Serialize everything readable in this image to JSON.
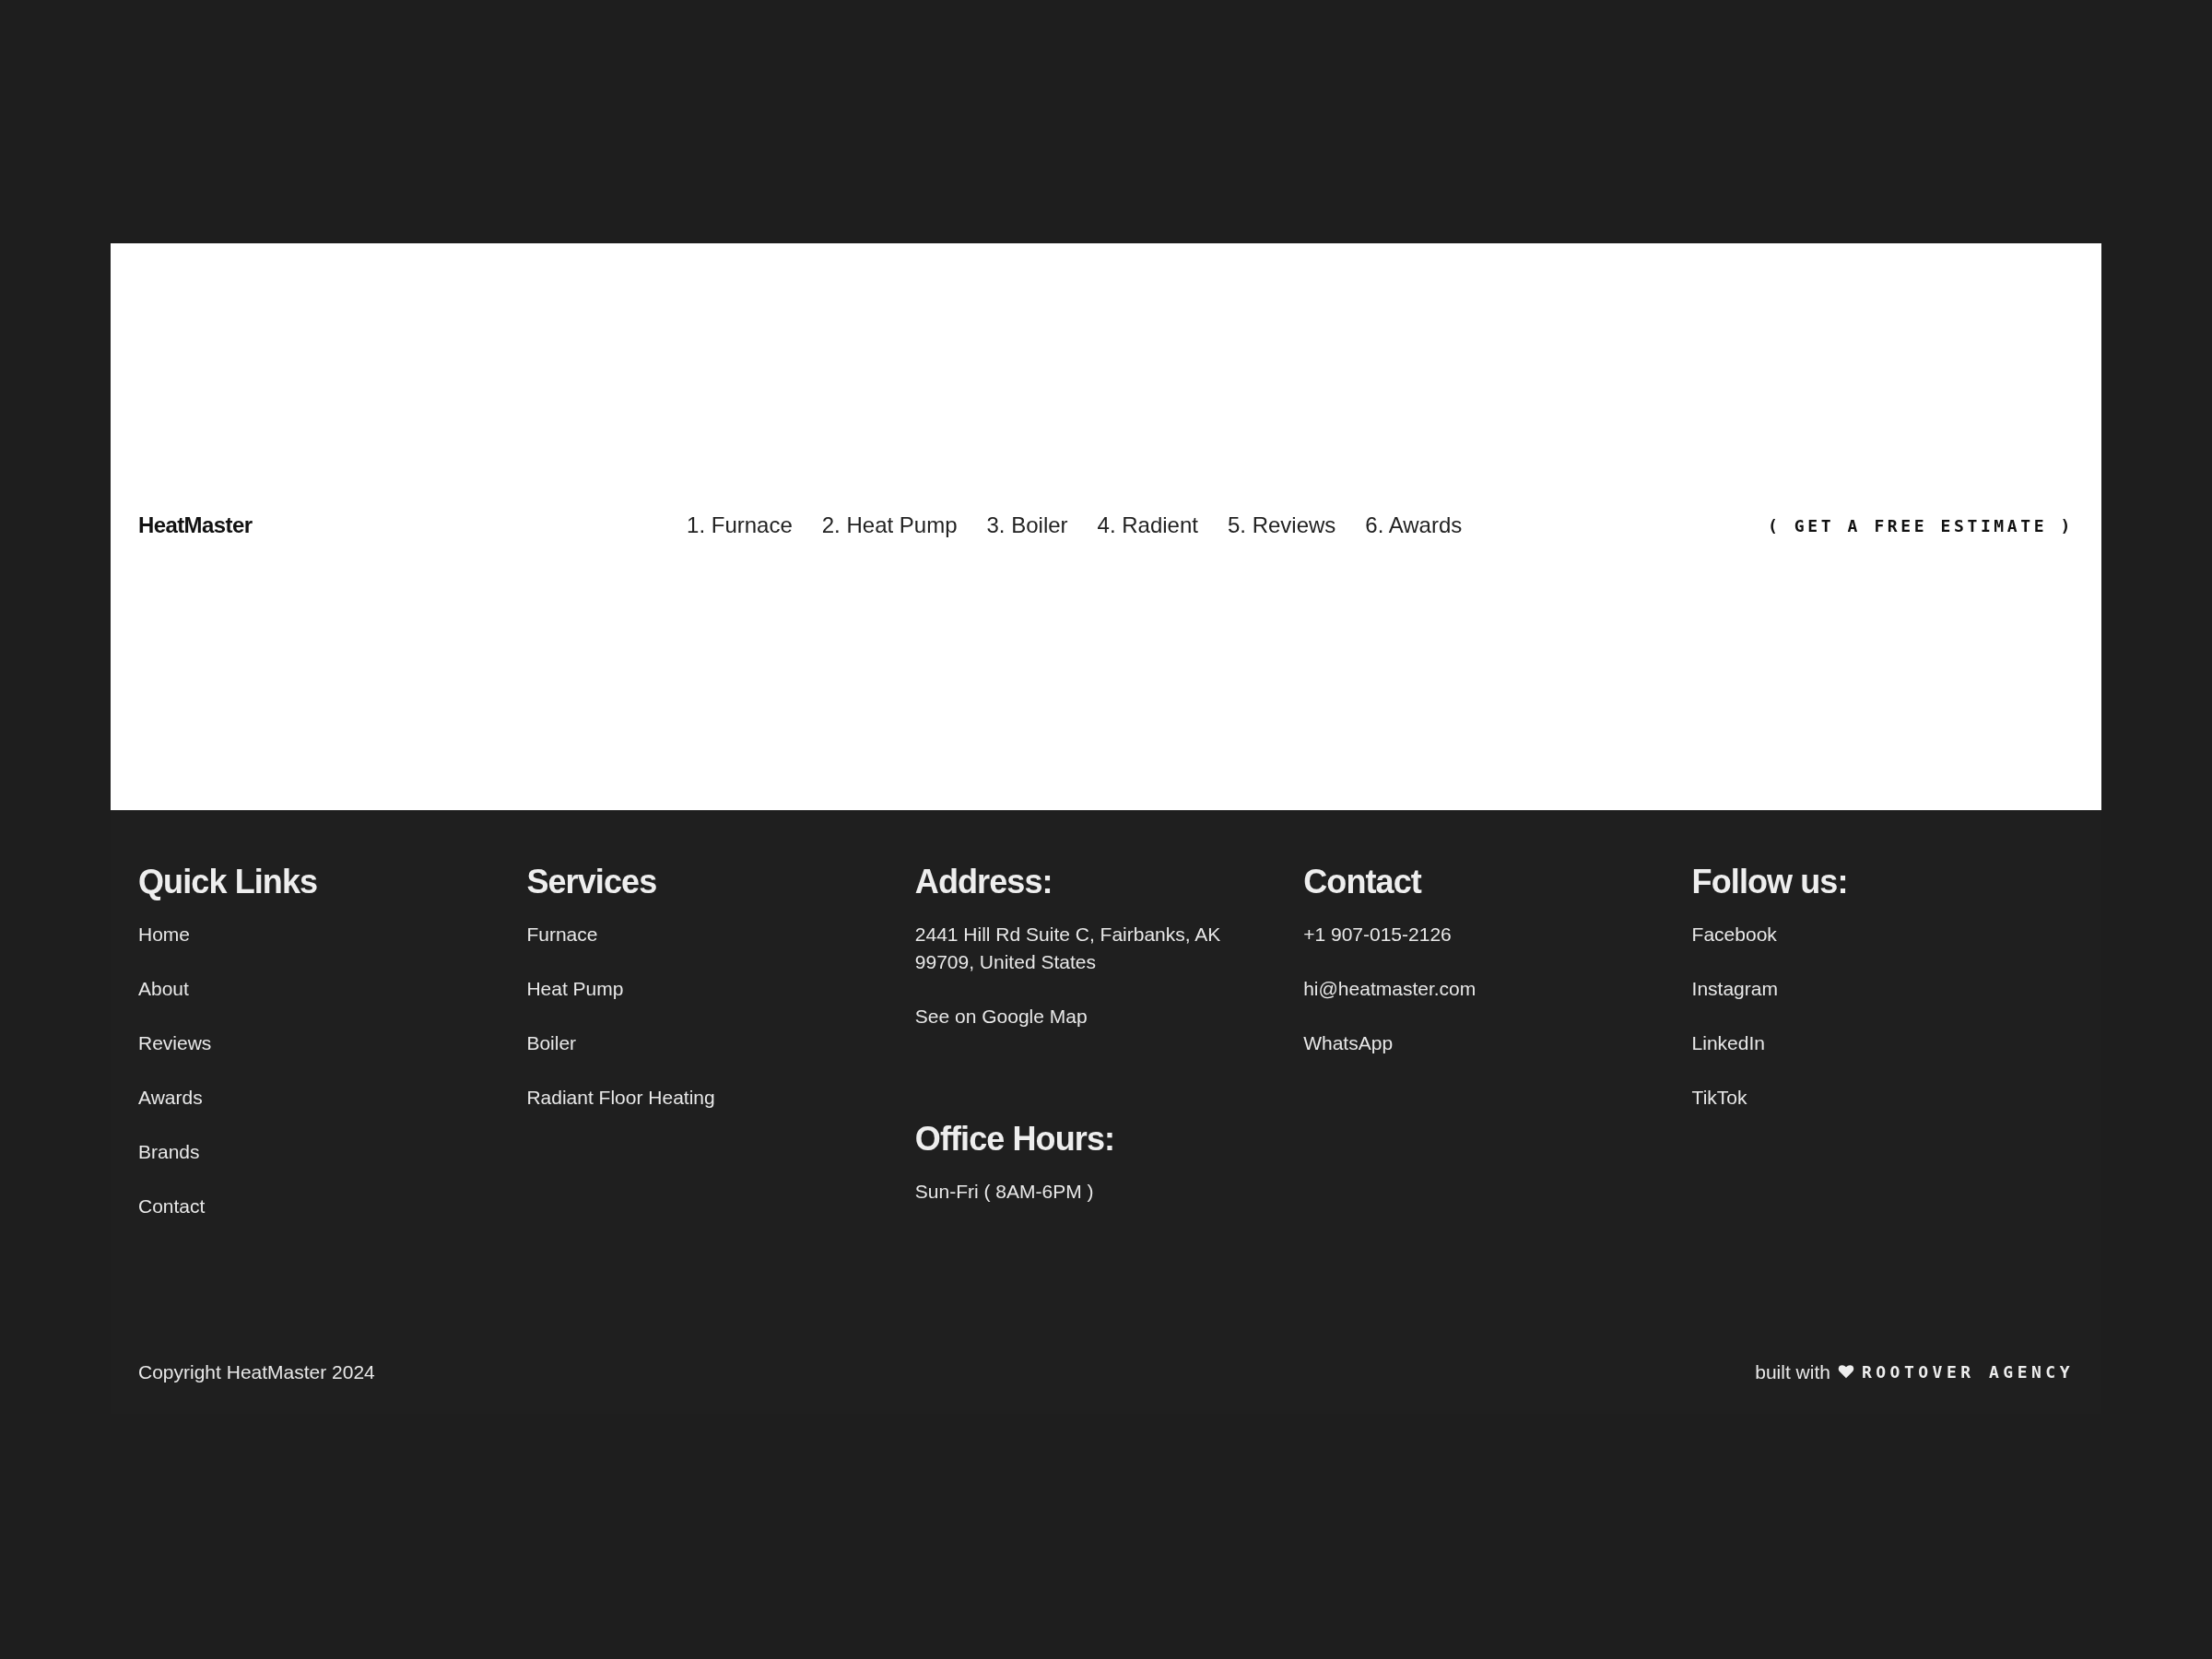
{
  "header": {
    "logo": "HeatMaster",
    "nav": [
      "1. Furnace",
      "2. Heat Pump",
      "3. Boiler",
      "4. Radient",
      "5. Reviews",
      "6. Awards"
    ],
    "cta": "( GET A FREE ESTIMATE )"
  },
  "footer": {
    "columns": [
      {
        "sections": [
          {
            "heading": "Quick Links",
            "links": [
              "Home",
              "About",
              "Reviews",
              "Awards",
              "Brands",
              "Contact"
            ]
          }
        ]
      },
      {
        "sections": [
          {
            "heading": "Services",
            "links": [
              "Furnace",
              "Heat Pump",
              "Boiler",
              "Radiant Floor Heating"
            ]
          }
        ]
      },
      {
        "sections": [
          {
            "heading": "Address:",
            "links": [
              "2441 Hill Rd Suite C, Fairbanks, AK 99709, United States",
              "See on Google Map"
            ]
          },
          {
            "heading": "Office Hours:",
            "links": [
              "Sun-Fri ( 8AM-6PM )"
            ]
          }
        ]
      },
      {
        "sections": [
          {
            "heading": "Contact",
            "links": [
              "+1 907-015-2126",
              "hi@heatmaster.com",
              "WhatsApp"
            ]
          }
        ]
      },
      {
        "sections": [
          {
            "heading": "Follow us:",
            "links": [
              "Facebook",
              "Instagram",
              "LinkedIn",
              "TikTok"
            ]
          }
        ]
      }
    ],
    "copyright": "Copyright HeatMaster 2024",
    "built_with": "built with",
    "agency": "ROOTOVER AGENCY"
  }
}
